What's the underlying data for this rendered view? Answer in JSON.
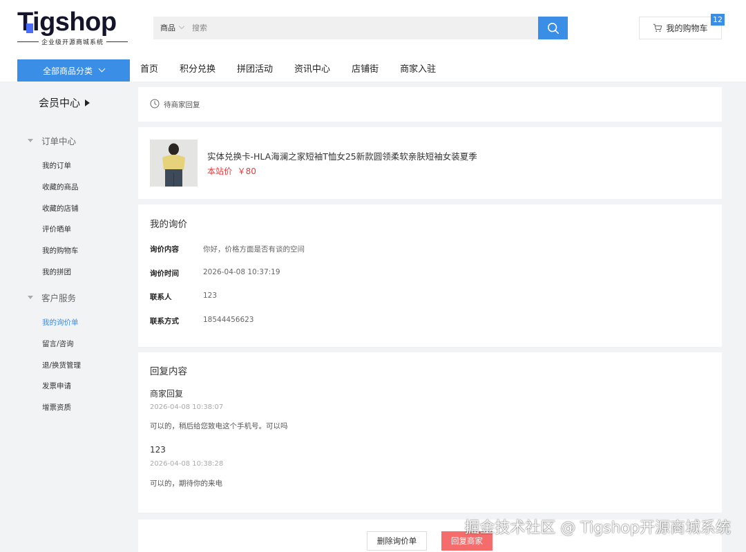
{
  "brand": {
    "logo_text": "Tigshop",
    "tagline": "企业级开源商城系统"
  },
  "search": {
    "category": "商品",
    "placeholder": "搜索",
    "icon": "search-icon"
  },
  "cart": {
    "label": "我的购物车",
    "count": "12",
    "icon": "cart-icon"
  },
  "nav": {
    "category_button": "全部商品分类",
    "items": [
      "首页",
      "积分兑换",
      "拼团活动",
      "资讯中心",
      "店铺街",
      "商家入驻"
    ]
  },
  "sidebar": {
    "title": "会员中心",
    "groups": [
      {
        "label": "订单中心",
        "items": [
          "我的订单",
          "收藏的商品",
          "收藏的店铺",
          "评价晒单",
          "我的购物车",
          "我的拼团"
        ]
      },
      {
        "label": "客户服务",
        "items": [
          "我的询价单",
          "留言/咨询",
          "退/换货管理",
          "发票申请",
          "增票资质"
        ]
      }
    ],
    "active_item": "我的询价单"
  },
  "status": {
    "text": "待商家回复",
    "icon": "clock-icon"
  },
  "goods": {
    "name": "实体兑换卡-HLA海澜之家短袖T恤女25新款圆领柔软亲肤短袖女装夏季",
    "price_label": "本站价",
    "price": "￥80"
  },
  "inquiry": {
    "title": "我的询价",
    "fields": [
      {
        "label": "询价内容",
        "value": "你好，价格方面是否有谈的空间"
      },
      {
        "label": "询价时间",
        "value": "2026-04-08 10:37:19"
      },
      {
        "label": "联系人",
        "value": "123"
      },
      {
        "label": "联系方式",
        "value": "18544456623"
      }
    ]
  },
  "reply": {
    "title": "回复内容",
    "entries": [
      {
        "name": "商家回复",
        "time": "2026-04-08 10:38:07",
        "text": "可以的，稍后给您致电这个手机号。可以吗"
      },
      {
        "name": "123",
        "time": "2026-04-08 10:38:28",
        "text": "可以的，期待你的来电"
      }
    ]
  },
  "actions": {
    "delete": "删除询价单",
    "reply": "回复商家"
  },
  "watermark": "掘金技术社区 @ Tigshop开源商城系统",
  "colors": {
    "accent": "#3a8ee6",
    "price": "#e4393c",
    "reply_button": "#f56c6c"
  }
}
